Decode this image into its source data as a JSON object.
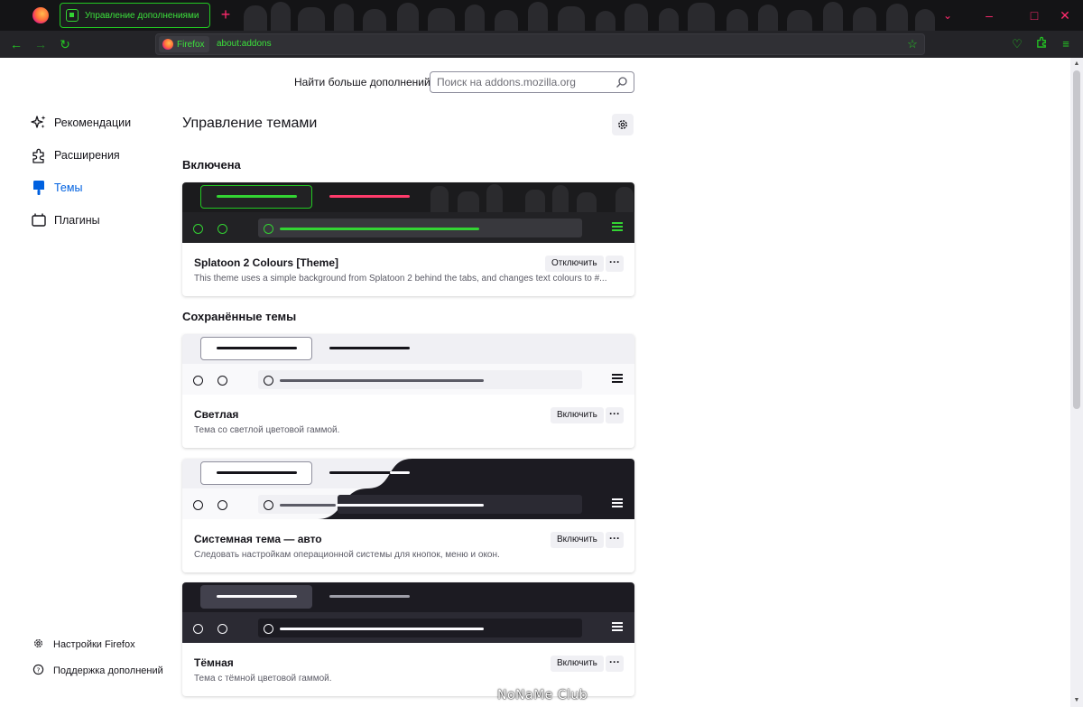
{
  "browser": {
    "active_tab_title": "Управление дополнениями",
    "identity_label": "Firefox",
    "url": "about:addons",
    "new_tab_symbol": "+",
    "accent_color": "#22c922",
    "tab_accent_color": "#ff2a6d"
  },
  "search": {
    "label": "Найти больше дополнений",
    "placeholder": "Поиск на addons.mozilla.org"
  },
  "sidebar": {
    "items": [
      {
        "label": "Рекомендации",
        "icon": "sparkle-icon"
      },
      {
        "label": "Расширения",
        "icon": "puzzle-icon"
      },
      {
        "label": "Темы",
        "icon": "brush-icon",
        "selected": true
      },
      {
        "label": "Плагины",
        "icon": "plugin-icon"
      }
    ],
    "footer": [
      {
        "label": "Настройки Firefox",
        "icon": "gear-icon"
      },
      {
        "label": "Поддержка дополнений",
        "icon": "help-icon"
      }
    ]
  },
  "main": {
    "title": "Управление темами",
    "enabled_heading": "Включена",
    "saved_heading": "Сохранённые темы",
    "enabled_theme": {
      "name": "Splatoon 2 Colours [Theme]",
      "description": "This theme uses a simple background from Splatoon 2 behind the tabs, and changes text colours to #...",
      "action": "Отключить",
      "more": "···"
    },
    "saved_themes": [
      {
        "name": "Светлая",
        "description": "Тема со светлой цветовой гаммой.",
        "action": "Включить",
        "more": "···"
      },
      {
        "name": "Системная тема — авто",
        "description": "Следовать настройкам операционной системы для кнопок, меню и окон.",
        "action": "Включить",
        "more": "···"
      },
      {
        "name": "Тёмная",
        "description": "Тема с тёмной цветовой гаммой.",
        "action": "Включить",
        "more": "···"
      }
    ]
  },
  "watermark": "NoNaMe Club"
}
